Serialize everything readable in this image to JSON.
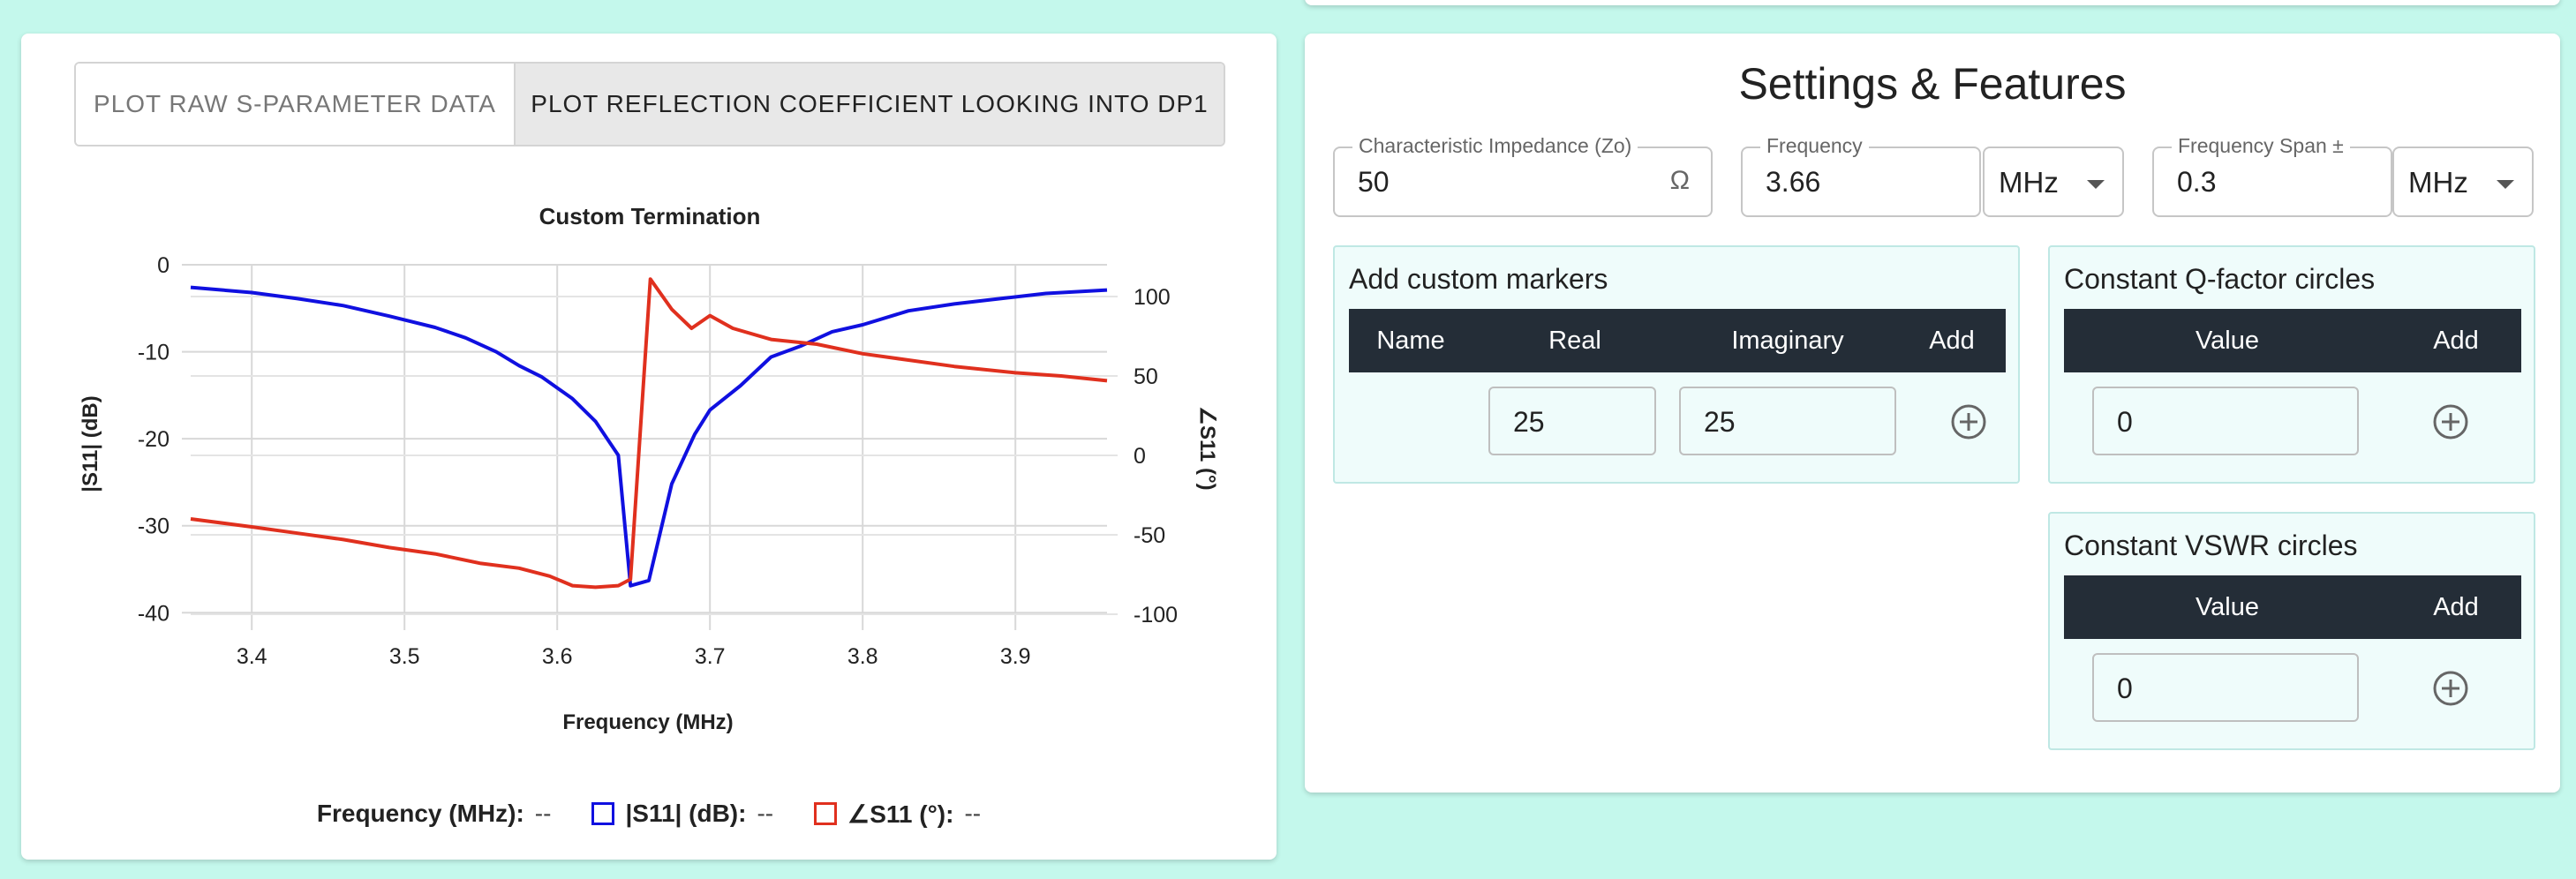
{
  "tabs": [
    {
      "label": "PLOT RAW S-PARAMETER DATA",
      "active": false
    },
    {
      "label": "PLOT REFLECTION COEFFICIENT LOOKING INTO DP1",
      "active": true
    }
  ],
  "chart_data": {
    "type": "line",
    "title": "Custom Termination",
    "xlabel": "Frequency (MHz)",
    "ylabel": "|S11| (dB)",
    "y2label": "∠S11 (°)",
    "xlim": [
      3.36,
      3.96
    ],
    "ylim": [
      -42,
      0
    ],
    "y2lim": [
      -110,
      120
    ],
    "xticks": [
      "3.4",
      "3.5",
      "3.6",
      "3.7",
      "3.8",
      "3.9"
    ],
    "yticks": [
      "0",
      "-10",
      "-20",
      "-30",
      "-40"
    ],
    "y2ticks": [
      "100",
      "50",
      "0",
      "-50",
      "-100"
    ],
    "grid": true,
    "series": [
      {
        "name": "|S11| (dB)",
        "color": "#1010e0",
        "axis": "left",
        "x": [
          3.36,
          3.4,
          3.43,
          3.46,
          3.49,
          3.52,
          3.54,
          3.56,
          3.575,
          3.59,
          3.61,
          3.625,
          3.64,
          3.648,
          3.66,
          3.675,
          3.69,
          3.7,
          3.72,
          3.74,
          3.76,
          3.78,
          3.8,
          3.83,
          3.86,
          3.89,
          3.92,
          3.96
        ],
        "values": [
          -2.6,
          -3.2,
          -3.9,
          -4.7,
          -5.9,
          -7.2,
          -8.4,
          -10.0,
          -11.6,
          -12.9,
          -15.4,
          -18.0,
          -21.9,
          -36.9,
          -36.3,
          -25.2,
          -19.5,
          -16.7,
          -13.9,
          -10.6,
          -9.3,
          -7.7,
          -6.9,
          -5.3,
          -4.5,
          -3.9,
          -3.3,
          -2.9
        ]
      },
      {
        "name": "∠S11 (°)",
        "color": "#e0301e",
        "axis": "right",
        "x": [
          3.36,
          3.4,
          3.43,
          3.46,
          3.49,
          3.52,
          3.55,
          3.575,
          3.595,
          3.61,
          3.625,
          3.64,
          3.648,
          3.661,
          3.675,
          3.688,
          3.7,
          3.715,
          3.74,
          3.77,
          3.8,
          3.83,
          3.86,
          3.9,
          3.93,
          3.96
        ],
        "values": [
          -40,
          -45,
          -49,
          -53,
          -58,
          -62,
          -68,
          -71,
          -76,
          -82,
          -83,
          -82,
          -78,
          111,
          92,
          80,
          88,
          80,
          73,
          70,
          64,
          60,
          56,
          52,
          50,
          47
        ]
      }
    ]
  },
  "readout": {
    "freq_label": "Frequency (MHz):",
    "freq_value": "--",
    "s11_label": "|S11| (dB):",
    "s11_value": "--",
    "angle_label": "∠S11 (°):",
    "angle_value": "--"
  },
  "settings": {
    "title": "Settings & Features",
    "zo": {
      "label": "Characteristic Impedance (Zo)",
      "value": "50",
      "unit": "Ω"
    },
    "frequency": {
      "label": "Frequency",
      "value": "3.66",
      "unit": "MHz"
    },
    "span": {
      "label": "Frequency Span ±",
      "value": "0.3",
      "unit": "MHz"
    }
  },
  "markers": {
    "title": "Add custom markers",
    "headers": [
      "Name",
      "Real",
      "Imaginary",
      "Add"
    ],
    "real": "25",
    "imag": "25"
  },
  "qfactor": {
    "title": "Constant Q-factor circles",
    "headers": [
      "Value",
      "Add"
    ],
    "value": "0"
  },
  "vswr": {
    "title": "Constant VSWR circles",
    "headers": [
      "Value",
      "Add"
    ],
    "value": "0"
  },
  "colors": {
    "background": "#c4f8ec",
    "header_dark": "#242d37",
    "panel_bg": "#effcfb"
  }
}
